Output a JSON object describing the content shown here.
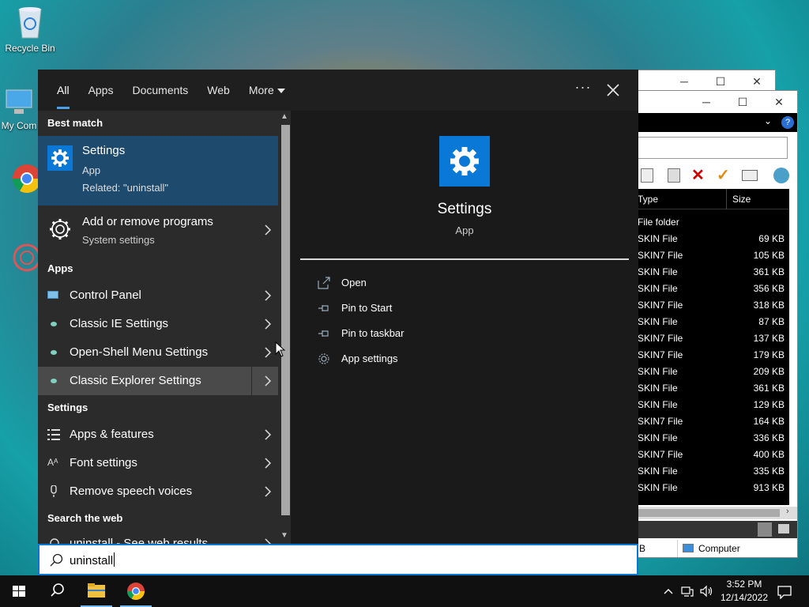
{
  "desktop": {
    "icons": [
      {
        "label": "Recycle Bin"
      },
      {
        "label": "My Com"
      }
    ]
  },
  "explorer": {
    "column_type": "Type",
    "column_size": "Size",
    "rows": [
      {
        "type": "File folder",
        "size": ""
      },
      {
        "type": "SKIN File",
        "size": "69 KB"
      },
      {
        "type": "SKIN7 File",
        "size": "105 KB"
      },
      {
        "type": "SKIN File",
        "size": "361 KB"
      },
      {
        "type": "SKIN File",
        "size": "356 KB"
      },
      {
        "type": "SKIN7 File",
        "size": "318 KB"
      },
      {
        "type": "SKIN File",
        "size": "87 KB"
      },
      {
        "type": "SKIN7 File",
        "size": "137 KB"
      },
      {
        "type": "SKIN7 File",
        "size": "179 KB"
      },
      {
        "type": "SKIN File",
        "size": "209 KB"
      },
      {
        "type": "SKIN File",
        "size": "361 KB"
      },
      {
        "type": "SKIN File",
        "size": "129 KB"
      },
      {
        "type": "SKIN7 File",
        "size": "164 KB"
      },
      {
        "type": "SKIN File",
        "size": "336 KB"
      },
      {
        "type": "SKIN7 File",
        "size": "400 KB"
      },
      {
        "type": "SKIN File",
        "size": "335 KB"
      },
      {
        "type": "SKIN File",
        "size": "913 KB"
      }
    ],
    "status_left": "B",
    "status_computer": "Computer"
  },
  "search": {
    "tabs": [
      "All",
      "Apps",
      "Documents",
      "Web",
      "More"
    ],
    "more_options": "···",
    "best_match_title": "Best match",
    "best_match": {
      "name": "Settings",
      "type": "App",
      "related": "Related: \"uninstall\""
    },
    "second": {
      "name": "Add or remove programs",
      "sub": "System settings"
    },
    "apps_title": "Apps",
    "apps": [
      "Control Panel",
      "Classic IE Settings",
      "Open-Shell Menu Settings",
      "Classic Explorer Settings"
    ],
    "settings_title": "Settings",
    "settings": [
      "Apps & features",
      "Font settings",
      "Remove speech voices"
    ],
    "web_title": "Search the web",
    "web_partial": "uninstall - See web results",
    "detail": {
      "name": "Settings",
      "type": "App"
    },
    "actions": [
      "Open",
      "Pin to Start",
      "Pin to taskbar",
      "App settings"
    ],
    "query": "uninstall"
  },
  "taskbar": {
    "time": "3:52 PM",
    "date": "12/14/2022"
  },
  "colors": {
    "accent": "#0a78d7",
    "panel": "#2b2b2b",
    "highlight": "#1e4a6e"
  }
}
